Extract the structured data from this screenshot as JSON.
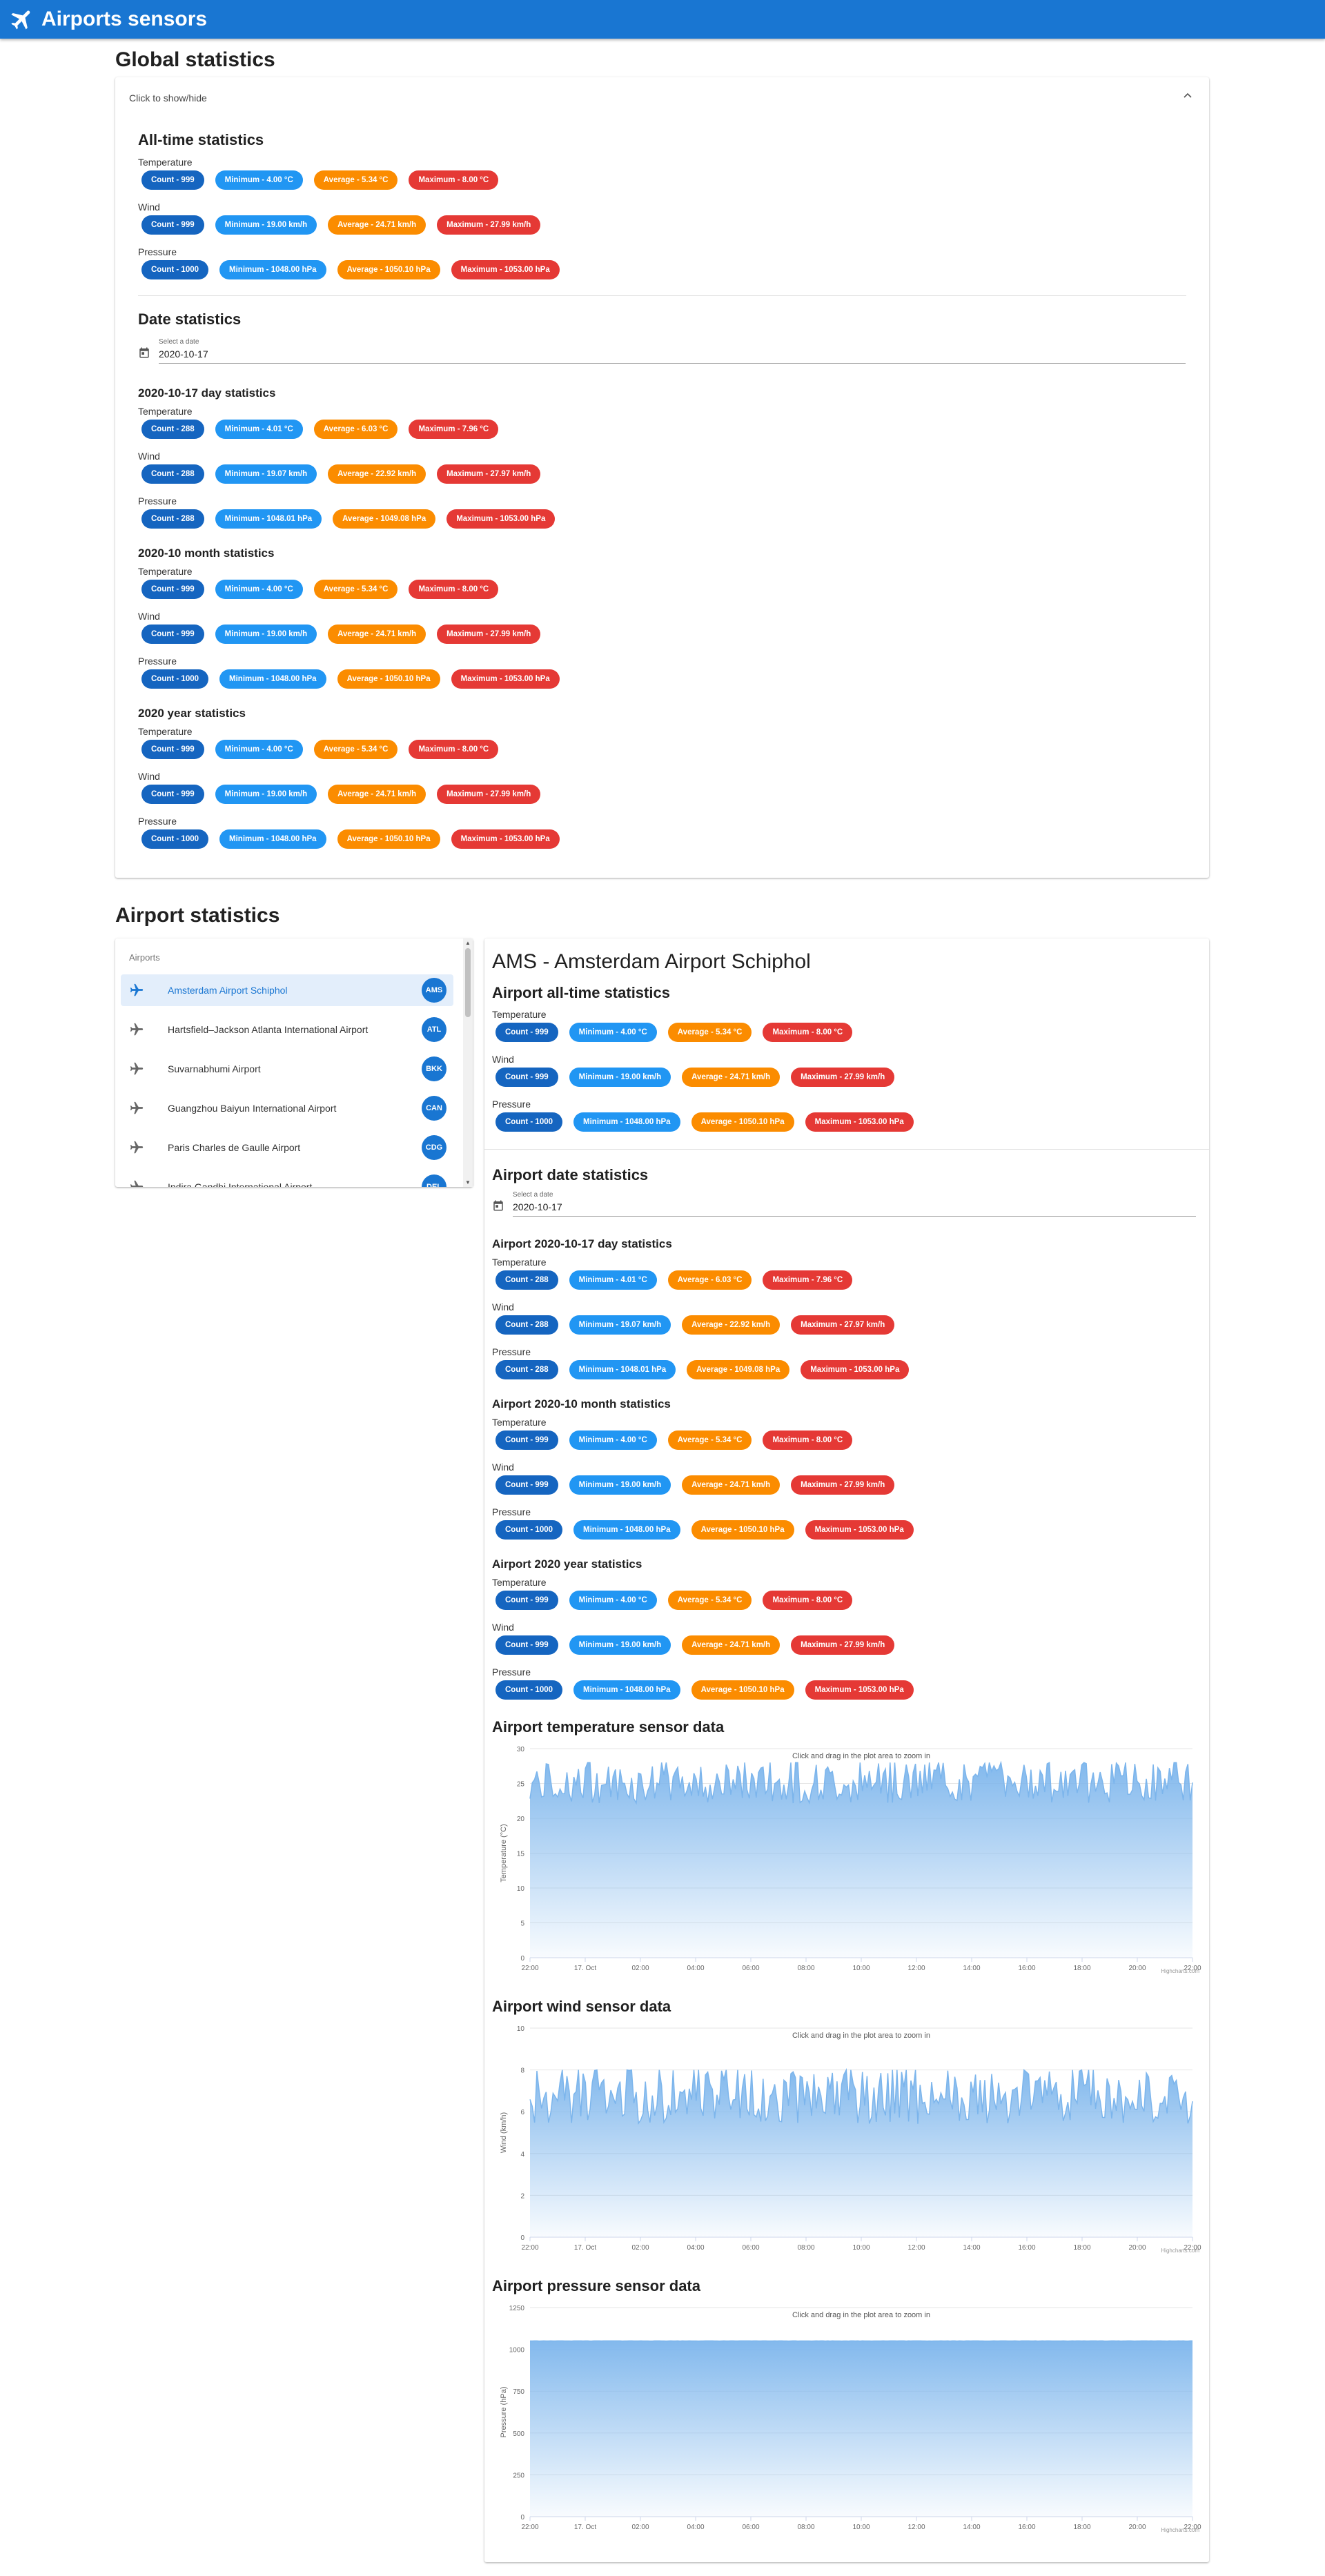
{
  "app": {
    "title": "Airports sensors"
  },
  "global": {
    "title": "Global statistics",
    "toggle_label": "Click to show/hide",
    "all_time_title": "All-time statistics",
    "date_title": "Date statistics",
    "date_label": "Select a date",
    "date_value": "2020-10-17",
    "blocks": [
      {
        "rows": [
          {
            "label": "Temperature",
            "chips": [
              "Count - 999",
              "Minimum - 4.00 °C",
              "Average - 5.34 °C",
              "Maximum - 8.00 °C"
            ]
          },
          {
            "label": "Wind",
            "chips": [
              "Count - 999",
              "Minimum - 19.00 km/h",
              "Average - 24.71 km/h",
              "Maximum - 27.99 km/h"
            ]
          },
          {
            "label": "Pressure",
            "chips": [
              "Count - 1000",
              "Minimum - 1048.00 hPa",
              "Average - 1050.10 hPa",
              "Maximum - 1053.00 hPa"
            ]
          }
        ]
      },
      {
        "title": "2020-10-17 day statistics",
        "rows": [
          {
            "label": "Temperature",
            "chips": [
              "Count - 288",
              "Minimum - 4.01 °C",
              "Average - 6.03 °C",
              "Maximum - 7.96 °C"
            ]
          },
          {
            "label": "Wind",
            "chips": [
              "Count - 288",
              "Minimum - 19.07 km/h",
              "Average - 22.92 km/h",
              "Maximum - 27.97 km/h"
            ]
          },
          {
            "label": "Pressure",
            "chips": [
              "Count - 288",
              "Minimum - 1048.01 hPa",
              "Average - 1049.08 hPa",
              "Maximum - 1053.00 hPa"
            ]
          }
        ]
      },
      {
        "title": "2020-10 month statistics",
        "rows": [
          {
            "label": "Temperature",
            "chips": [
              "Count - 999",
              "Minimum - 4.00 °C",
              "Average - 5.34 °C",
              "Maximum - 8.00 °C"
            ]
          },
          {
            "label": "Wind",
            "chips": [
              "Count - 999",
              "Minimum - 19.00 km/h",
              "Average - 24.71 km/h",
              "Maximum - 27.99 km/h"
            ]
          },
          {
            "label": "Pressure",
            "chips": [
              "Count - 1000",
              "Minimum - 1048.00 hPa",
              "Average - 1050.10 hPa",
              "Maximum - 1053.00 hPa"
            ]
          }
        ]
      },
      {
        "title": "2020 year statistics",
        "rows": [
          {
            "label": "Temperature",
            "chips": [
              "Count - 999",
              "Minimum - 4.00 °C",
              "Average - 5.34 °C",
              "Maximum - 8.00 °C"
            ]
          },
          {
            "label": "Wind",
            "chips": [
              "Count - 999",
              "Minimum - 19.00 km/h",
              "Average - 24.71 km/h",
              "Maximum - 27.99 km/h"
            ]
          },
          {
            "label": "Pressure",
            "chips": [
              "Count - 1000",
              "Minimum - 1048.00 hPa",
              "Average - 1050.10 hPa",
              "Maximum - 1053.00 hPa"
            ]
          }
        ]
      }
    ]
  },
  "airports": {
    "title": "Airport statistics",
    "list_header": "Airports",
    "items": [
      {
        "name": "Amsterdam Airport Schiphol",
        "code": "AMS",
        "selected": true
      },
      {
        "name": "Hartsfield–Jackson Atlanta International Airport",
        "code": "ATL",
        "selected": false
      },
      {
        "name": "Suvarnabhumi Airport",
        "code": "BKK",
        "selected": false
      },
      {
        "name": "Guangzhou Baiyun International Airport",
        "code": "CAN",
        "selected": false
      },
      {
        "name": "Paris Charles de Gaulle Airport",
        "code": "CDG",
        "selected": false
      },
      {
        "name": "Indira Gandhi International Airport",
        "code": "DEL",
        "selected": false
      }
    ]
  },
  "detail": {
    "title": "AMS - Amsterdam Airport Schiphol",
    "all_time_title": "Airport all-time statistics",
    "date_title": "Airport date statistics",
    "date_label": "Select a date",
    "date_value": "2020-10-17",
    "blocks": [
      {
        "rows": [
          {
            "label": "Temperature",
            "chips": [
              "Count - 999",
              "Minimum - 4.00 °C",
              "Average - 5.34 °C",
              "Maximum - 8.00 °C"
            ]
          },
          {
            "label": "Wind",
            "chips": [
              "Count - 999",
              "Minimum - 19.00 km/h",
              "Average - 24.71 km/h",
              "Maximum - 27.99 km/h"
            ]
          },
          {
            "label": "Pressure",
            "chips": [
              "Count - 1000",
              "Minimum - 1048.00 hPa",
              "Average - 1050.10 hPa",
              "Maximum - 1053.00 hPa"
            ]
          }
        ]
      },
      {
        "title": "Airport 2020-10-17 day statistics",
        "rows": [
          {
            "label": "Temperature",
            "chips": [
              "Count - 288",
              "Minimum - 4.01 °C",
              "Average - 6.03 °C",
              "Maximum - 7.96 °C"
            ]
          },
          {
            "label": "Wind",
            "chips": [
              "Count - 288",
              "Minimum - 19.07 km/h",
              "Average - 22.92 km/h",
              "Maximum - 27.97 km/h"
            ]
          },
          {
            "label": "Pressure",
            "chips": [
              "Count - 288",
              "Minimum - 1048.01 hPa",
              "Average - 1049.08 hPa",
              "Maximum - 1053.00 hPa"
            ]
          }
        ]
      },
      {
        "title": "Airport 2020-10 month statistics",
        "rows": [
          {
            "label": "Temperature",
            "chips": [
              "Count - 999",
              "Minimum - 4.00 °C",
              "Average - 5.34 °C",
              "Maximum - 8.00 °C"
            ]
          },
          {
            "label": "Wind",
            "chips": [
              "Count - 999",
              "Minimum - 19.00 km/h",
              "Average - 24.71 km/h",
              "Maximum - 27.99 km/h"
            ]
          },
          {
            "label": "Pressure",
            "chips": [
              "Count - 1000",
              "Minimum - 1048.00 hPa",
              "Average - 1050.10 hPa",
              "Maximum - 1053.00 hPa"
            ]
          }
        ]
      },
      {
        "title": "Airport 2020 year statistics",
        "rows": [
          {
            "label": "Temperature",
            "chips": [
              "Count - 999",
              "Minimum - 4.00 °C",
              "Average - 5.34 °C",
              "Maximum - 8.00 °C"
            ]
          },
          {
            "label": "Wind",
            "chips": [
              "Count - 999",
              "Minimum - 19.00 km/h",
              "Average - 24.71 km/h",
              "Maximum - 27.99 km/h"
            ]
          },
          {
            "label": "Pressure",
            "chips": [
              "Count - 1000",
              "Minimum - 1048.00 hPa",
              "Average - 1050.10 hPa",
              "Maximum - 1053.00 hPa"
            ]
          }
        ]
      }
    ],
    "charts": [
      {
        "title": "Airport temperature sensor data"
      },
      {
        "title": "Airport wind sensor data"
      },
      {
        "title": "Airport pressure sensor data"
      }
    ]
  },
  "colors": {
    "count": "#1565c0",
    "minimum": "#2196f3",
    "average": "#fb8c00",
    "maximum": "#e53935",
    "appbar": "#1976d2",
    "series": "#7cb5ec"
  },
  "chart_data": [
    {
      "type": "area",
      "title": "",
      "subtitle": "Click and drag in the plot area to zoom in",
      "ylabel": "Temperature (°C)",
      "yticks": [
        "0",
        "5",
        "10",
        "15",
        "20",
        "25",
        "30"
      ],
      "ylim": [
        0,
        30
      ],
      "xticks": [
        "22:00",
        "17. Oct",
        "02:00",
        "04:00",
        "06:00",
        "08:00",
        "10:00",
        "12:00",
        "14:00",
        "16:00",
        "18:00",
        "20:00",
        "22:00"
      ],
      "series_range": [
        19,
        28
      ],
      "credits": "Highcharts.com"
    },
    {
      "type": "area",
      "title": "",
      "subtitle": "Click and drag in the plot area to zoom in",
      "ylabel": "Wind (km/h)",
      "yticks": [
        "0",
        "2",
        "4",
        "6",
        "8",
        "10"
      ],
      "ylim": [
        0,
        10
      ],
      "xticks": [
        "22:00",
        "17. Oct",
        "02:00",
        "04:00",
        "06:00",
        "08:00",
        "10:00",
        "12:00",
        "14:00",
        "16:00",
        "18:00",
        "20:00",
        "22:00"
      ],
      "series_range": [
        4,
        8
      ],
      "credits": "Highcharts.com"
    },
    {
      "type": "area",
      "title": "",
      "subtitle": "Click and drag in the plot area to zoom in",
      "ylabel": "Pressure (hPa)",
      "yticks": [
        "0",
        "250",
        "500",
        "750",
        "1000",
        "1250"
      ],
      "ylim": [
        0,
        1250
      ],
      "xticks": [
        "22:00",
        "17. Oct",
        "02:00",
        "04:00",
        "06:00",
        "08:00",
        "10:00",
        "12:00",
        "14:00",
        "16:00",
        "18:00",
        "20:00",
        "22:00"
      ],
      "series_range": [
        1048,
        1053
      ],
      "credits": "Highcharts.com"
    }
  ]
}
